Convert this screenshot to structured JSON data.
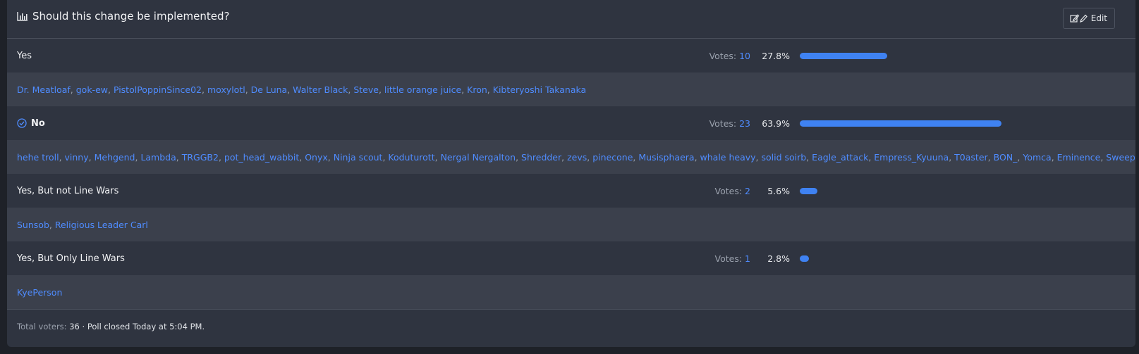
{
  "poll": {
    "title": "Should this change be implemented?",
    "edit_label": "Edit",
    "votes_label": "Votes:",
    "bar_color": "#3f82f2",
    "link_color": "#4f8cff",
    "answers": [
      {
        "label": "Yes",
        "votes": "10",
        "percent_text": "27.8%",
        "percent": 27.8,
        "voted_by_me": false,
        "voters": [
          "Dr. Meatloaf",
          "gok-ew",
          "PistolPoppinSince02",
          "moxylotl",
          "De Luna",
          "Walter Black",
          "Steve",
          "little orange juice",
          "Kron",
          "Kibteryoshi Takanaka"
        ]
      },
      {
        "label": "No",
        "votes": "23",
        "percent_text": "63.9%",
        "percent": 63.9,
        "voted_by_me": true,
        "voters": [
          "hehe troll",
          "vinny",
          "Mehgend",
          "Lambda",
          "TRGGB2",
          "pot_head_wabbit",
          "Onyx",
          "Ninja scout",
          "Koduturott",
          "Nergal Nergalton",
          "Shredder",
          "zevs",
          "pinecone",
          "Musisphaera",
          "whale heavy",
          "solid soirb",
          "Eagle_attack",
          "Empress_Kyuuna",
          "T0aster",
          "BON_",
          "Yomca",
          "Eminence",
          "Sweepy"
        ]
      },
      {
        "label": "Yes, But not Line Wars",
        "votes": "2",
        "percent_text": "5.6%",
        "percent": 5.6,
        "voted_by_me": false,
        "voters": [
          "Sunsob",
          "Religious Leader Carl"
        ]
      },
      {
        "label": "Yes, But Only Line Wars",
        "votes": "1",
        "percent_text": "2.8%",
        "percent": 2.8,
        "voted_by_me": false,
        "voters": [
          "KyePerson"
        ]
      }
    ],
    "footer": {
      "total_label": "Total voters:",
      "total_value": "36",
      "separator": "·",
      "closed_text": "Poll closed Today at 5:04 PM."
    }
  }
}
